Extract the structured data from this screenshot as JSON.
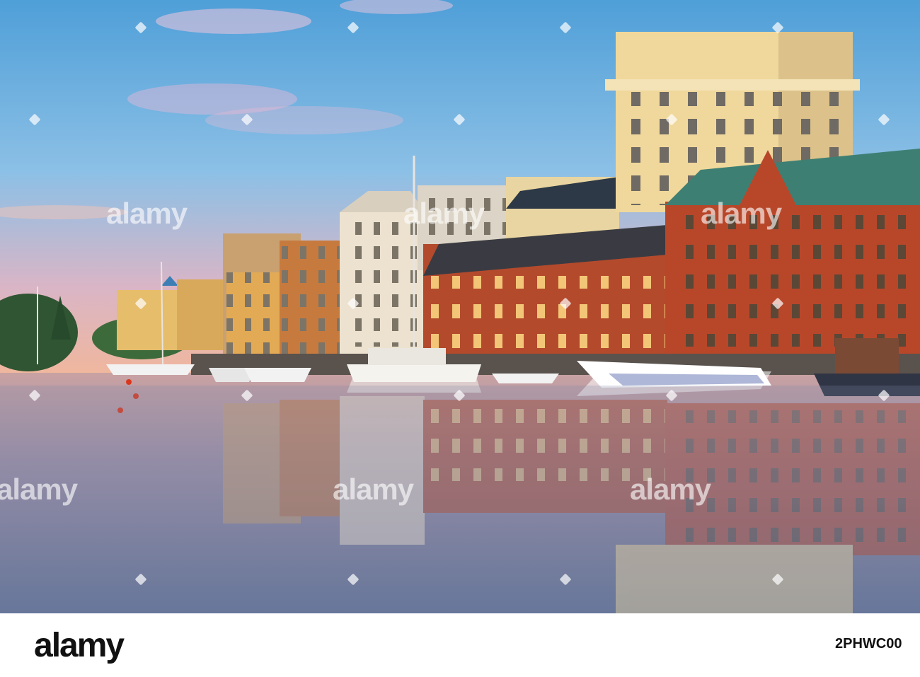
{
  "watermark": {
    "brand": "alamy"
  },
  "footer": {
    "logo": "alamy",
    "image_id": "2PHWC00"
  },
  "scene": {
    "sky_top": "#4f9fd8",
    "sky_horizon": "#f2b79a",
    "brick": "#b44a2c",
    "water": "#6e7ea0"
  }
}
